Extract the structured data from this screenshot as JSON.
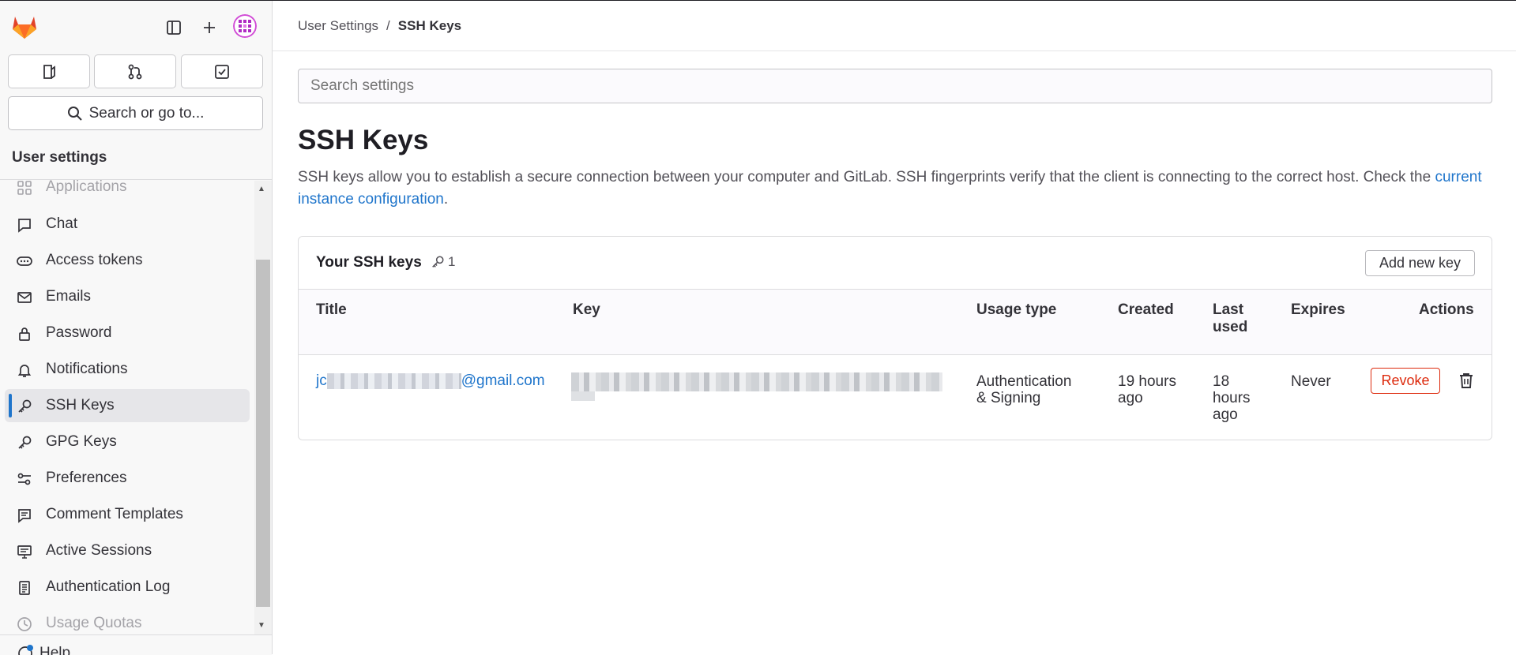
{
  "sidebar": {
    "search_label": "Search or go to...",
    "section_title": "User settings",
    "items": [
      {
        "label": "Applications",
        "icon": "applications-icon"
      },
      {
        "label": "Chat",
        "icon": "comment-icon"
      },
      {
        "label": "Access tokens",
        "icon": "token-icon"
      },
      {
        "label": "Emails",
        "icon": "mail-icon"
      },
      {
        "label": "Password",
        "icon": "lock-icon"
      },
      {
        "label": "Notifications",
        "icon": "bell-icon"
      },
      {
        "label": "SSH Keys",
        "icon": "key-icon"
      },
      {
        "label": "GPG Keys",
        "icon": "key-icon"
      },
      {
        "label": "Preferences",
        "icon": "preferences-icon"
      },
      {
        "label": "Comment Templates",
        "icon": "comment-lines-icon"
      },
      {
        "label": "Active Sessions",
        "icon": "monitor-icon"
      },
      {
        "label": "Authentication Log",
        "icon": "log-icon"
      },
      {
        "label": "Usage Quotas",
        "icon": "quota-icon"
      }
    ],
    "active_item": "SSH Keys",
    "bottom_label": "Help"
  },
  "breadcrumb": {
    "parent": "User Settings",
    "separator": "/",
    "current": "SSH Keys"
  },
  "main": {
    "search_placeholder": "Search settings",
    "title": "SSH Keys",
    "description_before": "SSH keys allow you to establish a secure connection between your computer and GitLab. SSH fingerprints verify that the client is connecting to the correct host. Check the ",
    "description_link": "current instance configuration",
    "description_after": "."
  },
  "ssh_card": {
    "title": "Your SSH keys",
    "count": "1",
    "add_button": "Add new key",
    "columns": {
      "title": "Title",
      "key": "Key",
      "usage_type_1": "Usage type",
      "created": "Created",
      "last_used_1": "Last",
      "last_used_2": "used",
      "expires": "Expires",
      "actions": "Actions"
    },
    "row": {
      "title_prefix": "jc",
      "title_suffix": "@gmail.com",
      "usage_1": "Authentication",
      "usage_2": "& Signing",
      "created_1": "19 hours",
      "created_2": "ago",
      "last_used_1": "18",
      "last_used_2": "hours",
      "last_used_3": "ago",
      "expires": "Never",
      "revoke": "Revoke"
    }
  },
  "colors": {
    "accent": "#1f75cb",
    "danger": "#dd2b0e",
    "brand": "#e24329"
  }
}
